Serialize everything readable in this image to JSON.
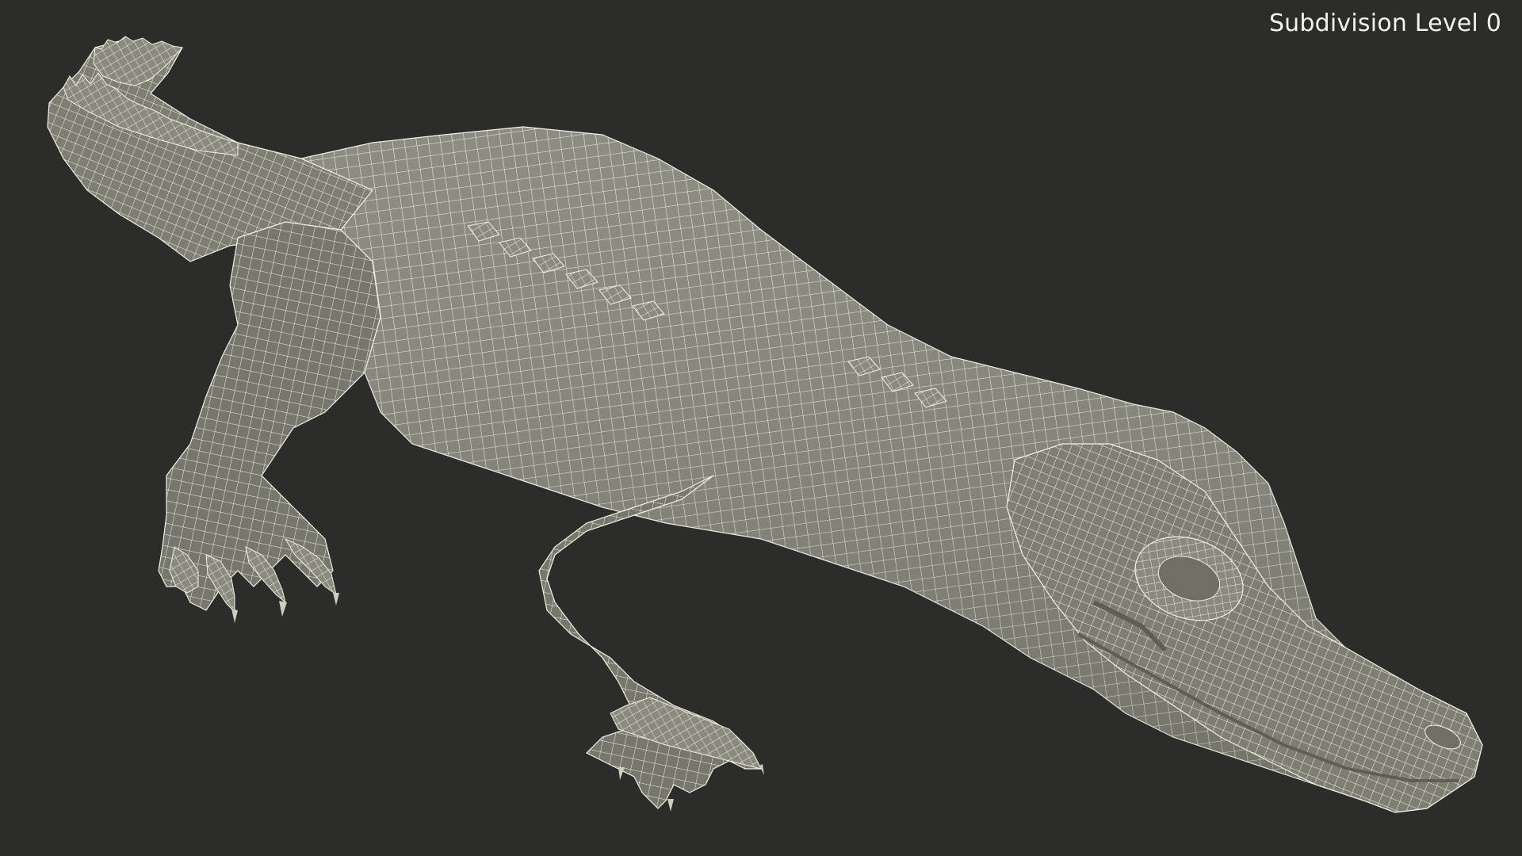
{
  "viewport": {
    "label": "Subdivision Level 0",
    "background_color": "#2c2c2a",
    "mesh_fill_color": "#85857a",
    "wire_color": "#f3f1e4"
  },
  "model": {
    "subject": "crocodile-wireframe-model"
  }
}
